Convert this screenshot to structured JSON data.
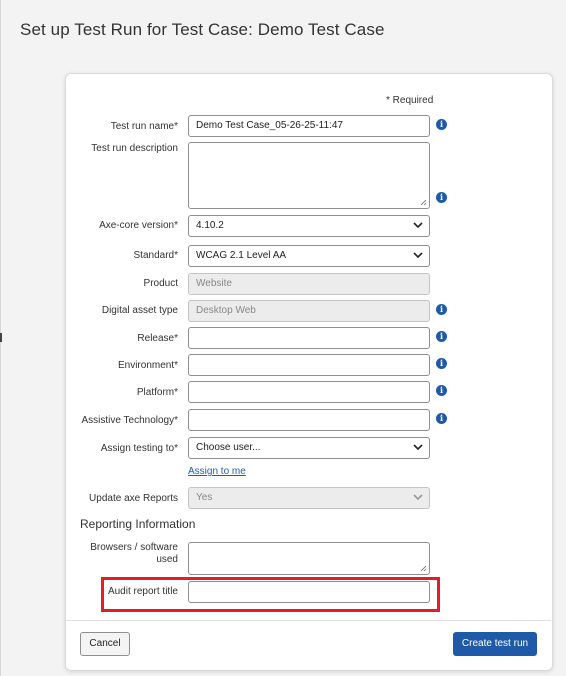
{
  "page": {
    "title": "Set up Test Run for Test Case: Demo Test Case"
  },
  "form": {
    "required_note": "* Required",
    "test_run_name": {
      "label": "Test run name*",
      "value": "Demo Test Case_05-26-25-11:47"
    },
    "test_run_description": {
      "label": "Test run description",
      "value": ""
    },
    "axe_core_version": {
      "label": "Axe-core version*",
      "value": "4.10.2"
    },
    "standard": {
      "label": "Standard*",
      "value": "WCAG 2.1 Level AA"
    },
    "product": {
      "label": "Product",
      "placeholder": "Website"
    },
    "digital_asset_type": {
      "label": "Digital asset type",
      "placeholder": "Desktop Web"
    },
    "release": {
      "label": "Release*",
      "value": ""
    },
    "environment": {
      "label": "Environment*",
      "value": ""
    },
    "platform": {
      "label": "Platform*",
      "value": ""
    },
    "assistive_technology": {
      "label": "Assistive Technology*",
      "value": ""
    },
    "assign_testing_to": {
      "label": "Assign testing to*",
      "value": "Choose user..."
    },
    "assign_to_me": "Assign to me",
    "update_axe_reports": {
      "label": "Update axe Reports",
      "value": "Yes"
    },
    "reporting_section_title": "Reporting Information",
    "browsers_software_used": {
      "label_line1": "Browsers / software",
      "label_line2": "used",
      "value": ""
    },
    "audit_report_title": {
      "label": "Audit report title",
      "value": ""
    }
  },
  "footer": {
    "cancel_label": "Cancel",
    "create_label": "Create test run"
  },
  "colors": {
    "accent": "#1f5aa8",
    "highlight": "#e01e25",
    "info_icon": "#1e5aa8"
  }
}
